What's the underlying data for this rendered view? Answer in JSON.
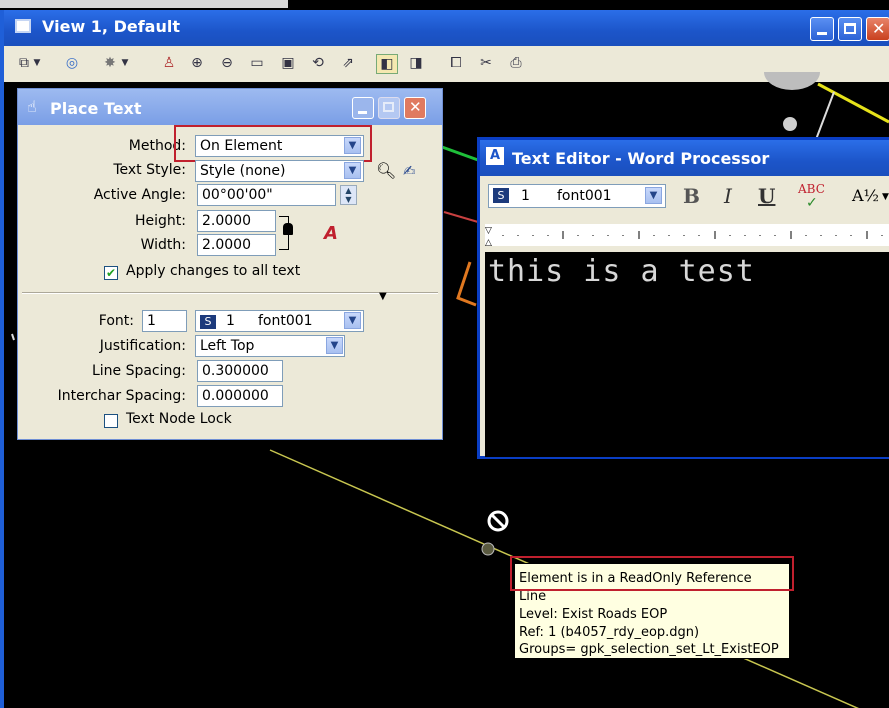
{
  "view_window": {
    "title": "View 1, Default",
    "toolbar_icons": [
      "view-attributes-icon",
      "display-style-icon",
      "lights-icon",
      "update-view-icon",
      "zoom-in-icon",
      "zoom-out-icon",
      "window-area-icon",
      "fit-view-icon",
      "rotate-view-icon",
      "pan-view-icon",
      "view-previous-icon",
      "view-next-icon",
      "copy-view-icon",
      "toggle-clip-icon",
      "camera-icon"
    ]
  },
  "place_text": {
    "title": "Place Text",
    "method_label": "Method:",
    "method_value": "On Element",
    "text_style_label": "Text Style:",
    "text_style_value": "Style (none)",
    "active_angle_label": "Active Angle:",
    "active_angle_value": "00°00'00\"",
    "height_label": "Height:",
    "height_value": "2.0000",
    "width_label": "Width:",
    "width_value": "2.0000",
    "apply_changes_label": "Apply changes to all text",
    "apply_changes_checked": true,
    "font_label": "Font:",
    "font_number": "1",
    "font_combo_number": "1",
    "font_combo_name": "font001",
    "justification_label": "Justification:",
    "justification_value": "Left Top",
    "line_spacing_label": "Line Spacing:",
    "line_spacing_value": "0.300000",
    "interchar_spacing_label": "Interchar Spacing:",
    "interchar_spacing_value": "0.000000",
    "text_node_lock_label": "Text Node Lock",
    "text_node_lock_checked": false
  },
  "text_editor": {
    "title": "Text Editor - Word Processor",
    "font_number": "1",
    "font_name": "font001",
    "bold_label": "B",
    "italic_label": "I",
    "underline_label": "U",
    "spell_label": "ABC",
    "fraction_label": "A½",
    "content": "this is a test"
  },
  "tooltip": {
    "lines": [
      "Element is in a ReadOnly Reference",
      "Line",
      "Level: Exist Roads EOP",
      "Ref: 1 (b4057_rdy_eop.dgn)",
      "Groups= gpk_selection_set_Lt_ExistEOP"
    ]
  },
  "colors": {
    "titlebar_blue": "#1c55c9",
    "inactive_titlebar": "#7a9ee6",
    "dialog_face": "#ece9d8",
    "highlight_red": "#c0202e",
    "yellow_line": "#e6e21a",
    "thin_line": "#c8c650",
    "green_line": "#1fbf3a",
    "orange_element": "#e07820"
  }
}
